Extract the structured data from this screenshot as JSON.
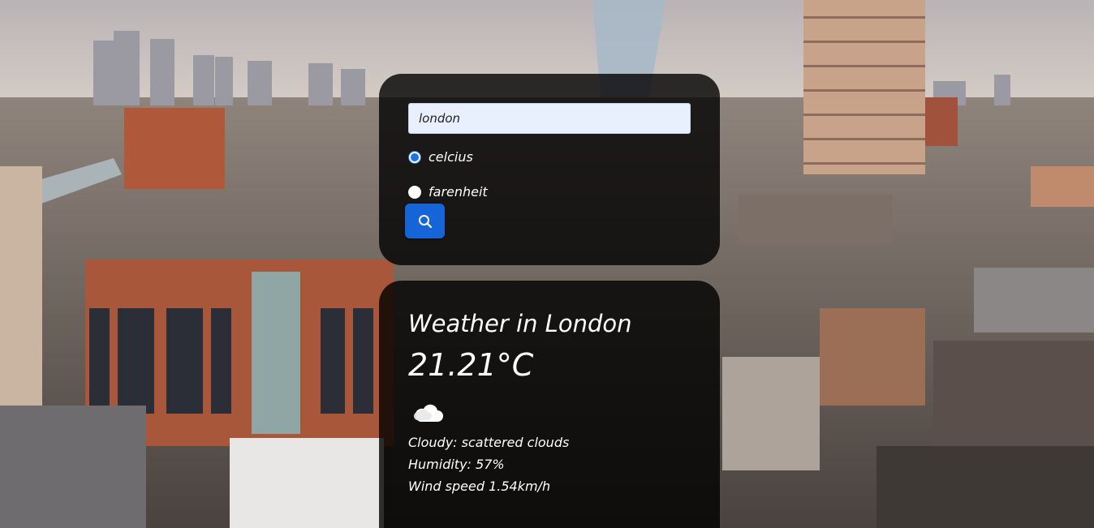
{
  "search": {
    "value": "london",
    "button_icon": "search-icon"
  },
  "units": {
    "options": [
      {
        "label": "celcius",
        "checked": true
      },
      {
        "label": "farenheit",
        "checked": false
      }
    ]
  },
  "weather": {
    "title": "Weather in London",
    "temperature": "21.21°C",
    "icon": "cloud-icon",
    "description": "Cloudy: scattered clouds",
    "humidity": "Humidity: 57%",
    "wind": "Wind speed 1.54km/h"
  },
  "colors": {
    "accent": "#1565d8",
    "card_background": "rgba(0,0,0,0.80)",
    "input_background": "#e8f0fe"
  }
}
